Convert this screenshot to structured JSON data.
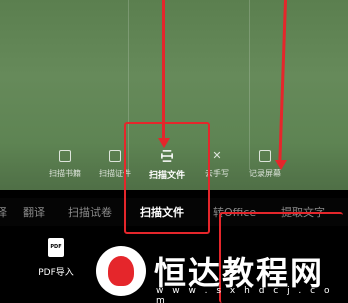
{
  "modes": [
    {
      "label": "扫描书籍",
      "icon": "book-icon"
    },
    {
      "label": "扫描证件",
      "icon": "id-card-icon"
    },
    {
      "label": "扫描文件",
      "icon": "scan-file-icon",
      "active": true
    },
    {
      "label": "去手写",
      "icon": "erase-handwriting-icon"
    },
    {
      "label": "记录屏幕",
      "icon": "screen-record-icon"
    }
  ],
  "tabs": [
    {
      "label": "译"
    },
    {
      "label": "翻译"
    },
    {
      "label": "扫描试卷"
    },
    {
      "label": "扫描文件",
      "active": true
    },
    {
      "label": "转Office"
    },
    {
      "label": "提取文字"
    }
  ],
  "pdf_import": {
    "label": "PDF导入",
    "icon_text": "PDF"
  },
  "watermark": {
    "title": "恒达教程网",
    "url": "w w w . s x h d c j . c o m"
  },
  "colors": {
    "highlight": "#e5262b",
    "preview_green": "#628656"
  }
}
